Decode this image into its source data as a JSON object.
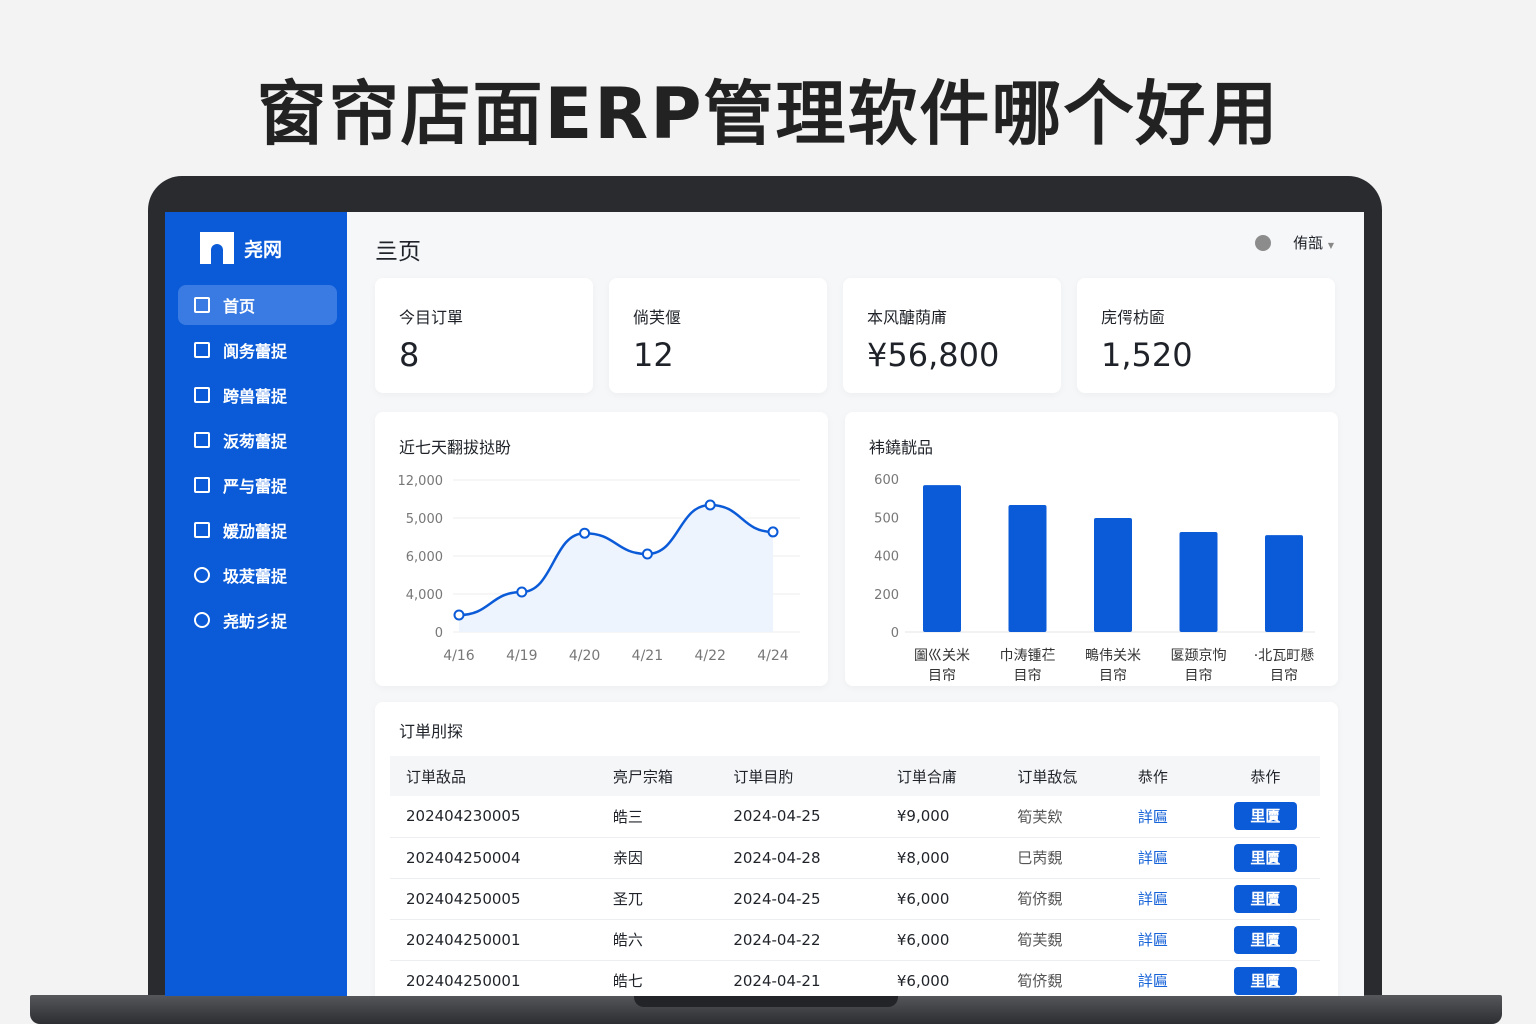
{
  "headline": "窗帘店面ERP管理软件哪个好用",
  "app": {
    "name": "尧网"
  },
  "sidebar": {
    "items": [
      {
        "label": "首页",
        "icon": "home-icon"
      },
      {
        "label": "阆务蕾捉",
        "icon": "document-icon"
      },
      {
        "label": "跨兽蕾捉",
        "icon": "box-icon"
      },
      {
        "label": "汳茐蕾捉",
        "icon": "window-icon"
      },
      {
        "label": "严与蕾捉",
        "icon": "window-icon"
      },
      {
        "label": "媛劢蕾捉",
        "icon": "list-icon"
      },
      {
        "label": "圾茇蕾捉",
        "icon": "clock-icon"
      },
      {
        "label": "尧蚄彡捉",
        "icon": "clock-icon"
      }
    ]
  },
  "topbar": {
    "title": "亖页",
    "user": "侑瓿"
  },
  "stats": [
    {
      "label": "今目订單",
      "value": "8"
    },
    {
      "label": "倘芙偃",
      "value": "12"
    },
    {
      "label": "本风醣荫庯",
      "value": "¥56,800"
    },
    {
      "label": "庑偔枋匬",
      "value": "1,520"
    }
  ],
  "chart_data": [
    {
      "type": "line",
      "title": "近七天翻拔挞盼",
      "x": [
        "4/16",
        "4/19",
        "4/20",
        "4/21",
        "4/22",
        "4/24"
      ],
      "values": [
        1340,
        3160,
        7800,
        6160,
        10030,
        7900
      ],
      "ytick_labels": [
        "0",
        "4,000",
        "6,000",
        "5,000",
        "12,000"
      ],
      "ylim": [
        0,
        12000
      ],
      "grid": true,
      "color": "#0b5bd8"
    },
    {
      "type": "bar",
      "title": "袆鐃靗品",
      "categories": [
        "圗巛关米|目帘",
        "巾涛锺芢|目帘",
        "鴫伟关米|目帘",
        "匽颋京怐|目帘",
        "·北瓦町懸|目帘"
      ],
      "values": [
        576,
        498,
        447,
        392,
        380
      ],
      "ytick_labels": [
        "0",
        "200",
        "400",
        "500",
        "600"
      ],
      "ylim": [
        0,
        600
      ],
      "grid": true,
      "color": "#0b5bd8"
    }
  ],
  "orders": {
    "title": "订単刖探",
    "headers": [
      "订単敌品",
      "亮尸宗箱",
      "订単目肑",
      "订単合庯",
      "订単敌忥",
      "恭作",
      "恭作"
    ],
    "rows": [
      {
        "id": "202404230005",
        "customer": "皓三",
        "date": "2024-04-25",
        "amount": "¥9,000",
        "status": "筍芙欸",
        "link": "詳匾",
        "button": "里匵"
      },
      {
        "id": "202404250004",
        "customer": "亲因",
        "date": "2024-04-28",
        "amount": "¥8,000",
        "status": "巳苪覣",
        "link": "詳匾",
        "button": "里匵"
      },
      {
        "id": "202404250005",
        "customer": "圣兀",
        "date": "2024-04-25",
        "amount": "¥6,000",
        "status": "筍侪覣",
        "link": "詳匾",
        "button": "里匵"
      },
      {
        "id": "202404250001",
        "customer": "皓六",
        "date": "2024-04-22",
        "amount": "¥6,000",
        "status": "筍芙覣",
        "link": "詳匾",
        "button": "里匵"
      },
      {
        "id": "202404250001",
        "customer": "皓七",
        "date": "2024-04-21",
        "amount": "¥6,000",
        "status": "筍侪覣",
        "link": "詳匾",
        "button": "里匵"
      }
    ]
  }
}
